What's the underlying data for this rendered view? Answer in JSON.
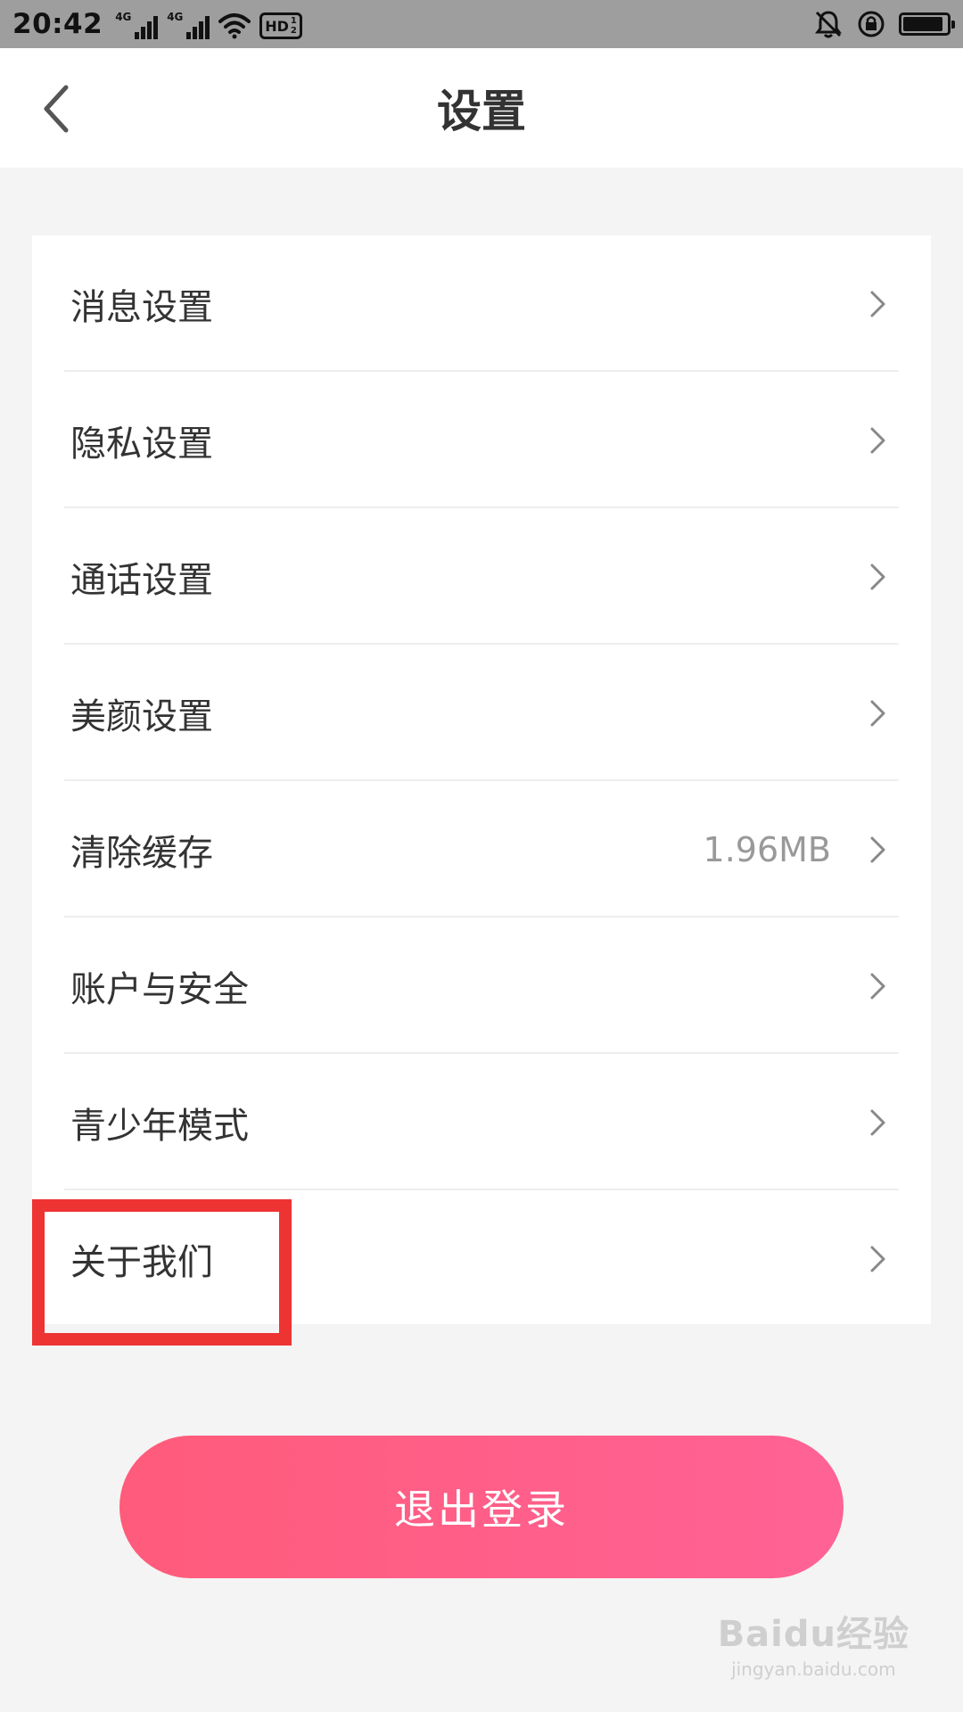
{
  "status_bar": {
    "time": "20:42",
    "network1": "4G",
    "network2": "4G",
    "hd_label": "HD",
    "hd_top": "1",
    "hd_bottom": "2",
    "icons": [
      "signal-icon",
      "signal-icon",
      "wifi-icon",
      "hd-icon",
      "mute-icon",
      "rotation-lock-icon",
      "battery-icon"
    ]
  },
  "header": {
    "title": "设置",
    "back_icon": "chevron-left-icon"
  },
  "settings": {
    "items": [
      {
        "label": "消息设置",
        "value": ""
      },
      {
        "label": "隐私设置",
        "value": ""
      },
      {
        "label": "通话设置",
        "value": ""
      },
      {
        "label": "美颜设置",
        "value": ""
      },
      {
        "label": "清除缓存",
        "value": "1.96MB"
      },
      {
        "label": "账户与安全",
        "value": ""
      },
      {
        "label": "青少年模式",
        "value": ""
      },
      {
        "label": "关于我们",
        "value": ""
      }
    ],
    "highlighted_index": 7
  },
  "logout": {
    "label": "退出登录"
  },
  "watermark": {
    "logo": "Baidu经验",
    "url": "jingyan.baidu.com"
  },
  "colors": {
    "accent_start": "#ff5b7b",
    "accent_end": "#ff6295",
    "highlight": "#ee3333"
  }
}
